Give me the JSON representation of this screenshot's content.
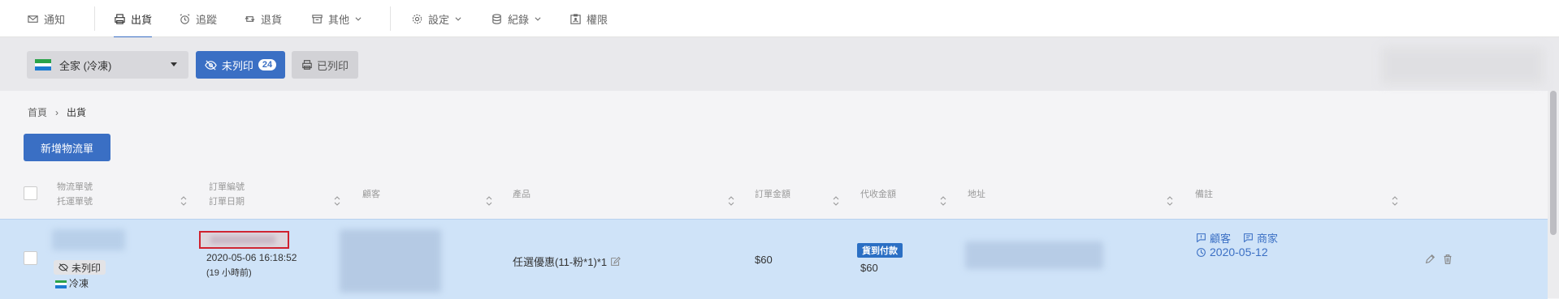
{
  "nav": {
    "notify": "通知",
    "ship": "出貨",
    "track": "追蹤",
    "returns": "退貨",
    "other": "其他",
    "settings": "設定",
    "records": "紀錄",
    "permissions": "權限"
  },
  "toolbar": {
    "store_select": "全家 (冷凍)",
    "unprinted_label": "未列印",
    "unprinted_count": "24",
    "printed_label": "已列印"
  },
  "breadcrumb": {
    "home": "首頁",
    "current": "出貨"
  },
  "new_button": "新增物流單",
  "table": {
    "headers": {
      "logistics_no": "物流單號",
      "consign_no": "托運單號",
      "order_no": "訂單編號",
      "order_date": "訂單日期",
      "customer": "顧客",
      "product": "產品",
      "order_amount": "訂單金額",
      "cod_amount": "代收金額",
      "address": "地址",
      "notes": "備註"
    },
    "row": {
      "print_status": "未列印",
      "temperature": "冷凍",
      "order_datetime": "2020-05-06 16:18:52",
      "relative_time": "(19 小時前)",
      "product": "任選優惠(11-粉*1)*1",
      "order_amount": "$60",
      "payment_badge": "貨到付款",
      "cod_amount": "$60",
      "note_customer": "顧客",
      "note_merchant": "商家",
      "note_date": "2020-05-12"
    }
  },
  "colors": {
    "accent": "#3a6fc4",
    "row_highlight": "#cfe3f8",
    "alert_border": "#d0212e"
  }
}
